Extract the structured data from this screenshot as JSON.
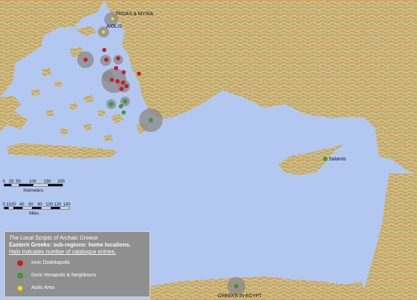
{
  "legend": {
    "title": "The Local Scripts of Archaic Greece",
    "subtitle": "Eastern Greeks: sub-regions: home locations.",
    "note": "Halo indicates number of catalogue entries.",
    "items": [
      {
        "label": "Ionic Dodekapolis",
        "color": "#e8131b"
      },
      {
        "label": "Doric Hexapolis & Neighbours",
        "color": "#3aa32a"
      },
      {
        "label": "Aiolic Area",
        "color": "#f2e21d"
      }
    ]
  },
  "places": {
    "troas": "TROAS & MYSIA",
    "aiolis": "AIOLIS",
    "salamis": "Salamis",
    "egypt": "GREEKS IN EGYPT"
  },
  "scale": {
    "km_ticks": [
      "0",
      "25",
      "50",
      "100",
      "150",
      "200"
    ],
    "km_label": "Kilometers",
    "mi_ticks": [
      "0",
      "10",
      "20",
      "40",
      "60",
      "80",
      "100",
      "120",
      "140"
    ],
    "mi_label": "Miles"
  },
  "colors": {
    "sea": "#b3c8f0",
    "land": "#cda466",
    "lowland": "#b8e3b0",
    "halo": "#8a8a8a"
  }
}
